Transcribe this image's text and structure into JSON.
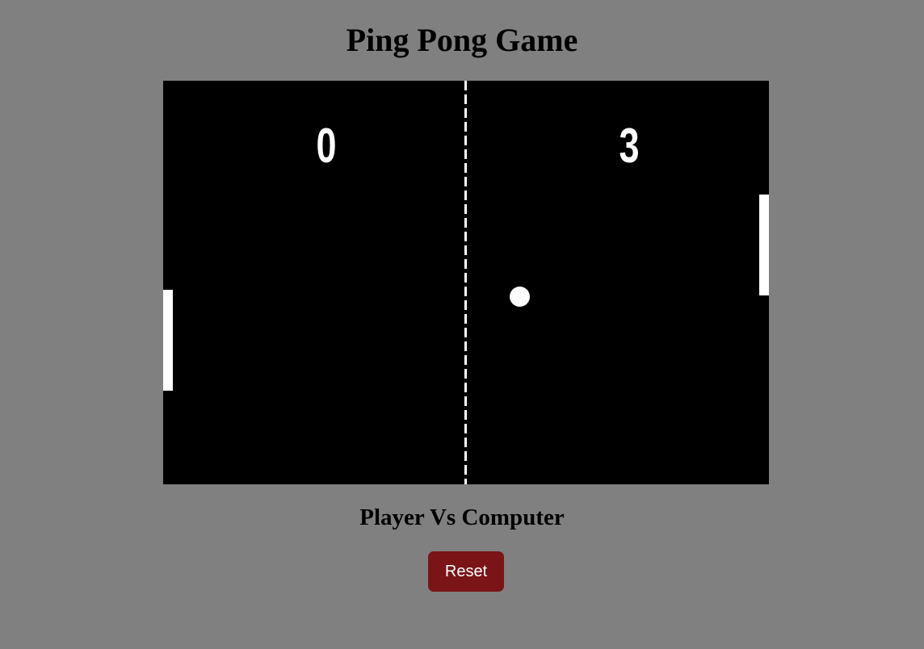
{
  "page": {
    "title": "Ping Pong Game",
    "mode_label": "Player Vs Computer"
  },
  "game": {
    "player_score": "0",
    "computer_score": "3"
  },
  "controls": {
    "reset_label": "Reset"
  },
  "colors": {
    "background": "#808080",
    "board": "#000000",
    "elements": "#ffffff",
    "reset_button": "#7a1416"
  }
}
